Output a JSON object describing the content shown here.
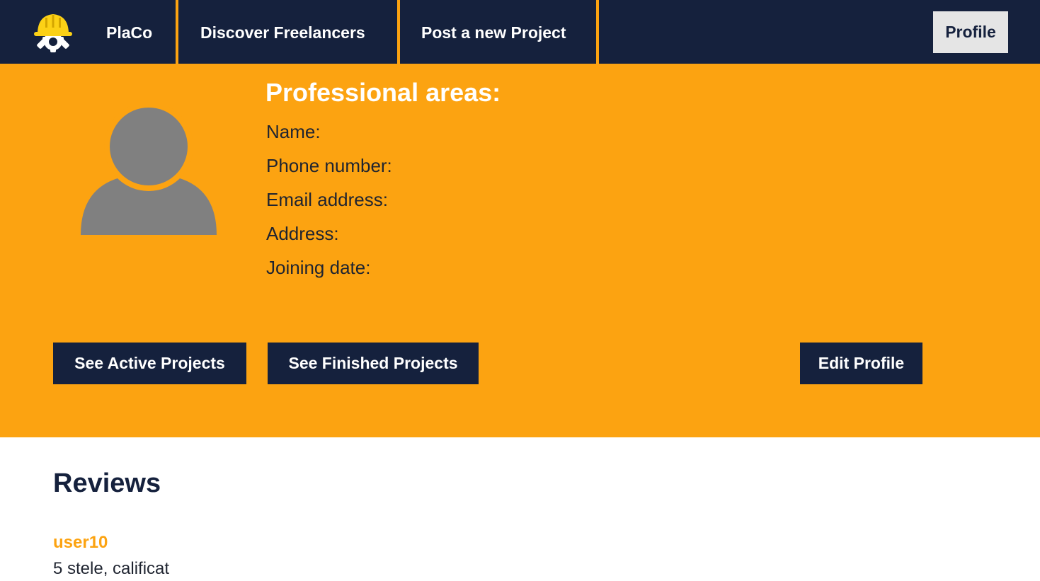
{
  "nav": {
    "brand": "PlaCo",
    "links": [
      "Discover Freelancers",
      "Post a new Project"
    ],
    "profile_label": "Profile"
  },
  "hero": {
    "title": "Professional areas:",
    "fields": [
      "Name:",
      "Phone number:",
      "Email address:",
      "Address:",
      "Joining date:"
    ],
    "buttons": {
      "active": "See Active Projects",
      "finished": "See Finished Projects",
      "edit": "Edit Profile"
    }
  },
  "reviews": {
    "title": "Reviews",
    "items": [
      {
        "user": "user10",
        "text": "5 stele, calificat"
      }
    ]
  },
  "colors": {
    "navy": "#15213d",
    "orange": "#fca311",
    "light_gray": "#e5e5e5",
    "avatar_gray": "#808080"
  },
  "icons": {
    "logo": "hardhat-gear-icon",
    "avatar": "user-silhouette-icon"
  }
}
